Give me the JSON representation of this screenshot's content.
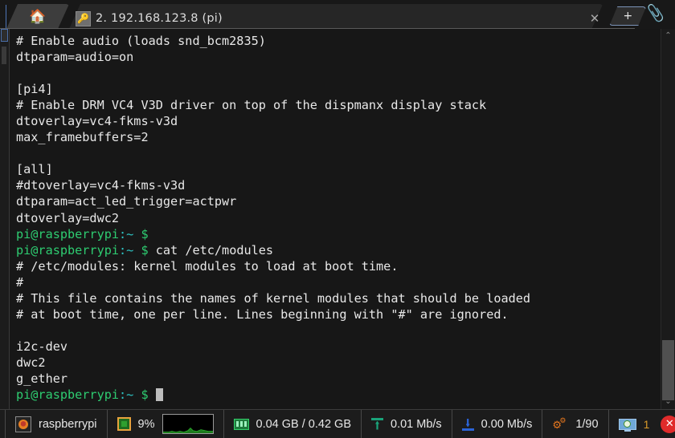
{
  "titlebar": {
    "home_tab": {
      "icon": "home-icon",
      "glyph": "🏠"
    },
    "terminal_tab": {
      "icon": "key-icon",
      "glyph": "🔑",
      "title": "2. 192.168.123.8 (pi)",
      "close_glyph": "✕"
    },
    "new_tab": {
      "label": "+"
    },
    "attachment": {
      "icon": "paperclip-icon",
      "glyph": "📎"
    }
  },
  "terminal": {
    "prompt_user": "pi@raspberrypi",
    "prompt_path": ":~",
    "prompt_sym": "$",
    "lines": [
      {
        "type": "plain",
        "text": "# Enable audio (loads snd_bcm2835)"
      },
      {
        "type": "plain",
        "text": "dtparam=audio=on"
      },
      {
        "type": "plain",
        "text": ""
      },
      {
        "type": "plain",
        "text": "[pi4]"
      },
      {
        "type": "plain",
        "text": "# Enable DRM VC4 V3D driver on top of the dispmanx display stack"
      },
      {
        "type": "plain",
        "text": "dtoverlay=vc4-fkms-v3d"
      },
      {
        "type": "plain",
        "text": "max_framebuffers=2"
      },
      {
        "type": "plain",
        "text": ""
      },
      {
        "type": "plain",
        "text": "[all]"
      },
      {
        "type": "plain",
        "text": "#dtoverlay=vc4-fkms-v3d"
      },
      {
        "type": "plain",
        "text": "dtparam=act_led_trigger=actpwr"
      },
      {
        "type": "plain",
        "text": "dtoverlay=dwc2"
      },
      {
        "type": "prompt",
        "command": ""
      },
      {
        "type": "prompt",
        "command": " cat /etc/modules"
      },
      {
        "type": "plain",
        "text": "# /etc/modules: kernel modules to load at boot time."
      },
      {
        "type": "plain",
        "text": "#"
      },
      {
        "type": "plain",
        "text": "# This file contains the names of kernel modules that should be loaded"
      },
      {
        "type": "plain",
        "text": "# at boot time, one per line. Lines beginning with \"#\" are ignored."
      },
      {
        "type": "plain",
        "text": ""
      },
      {
        "type": "plain",
        "text": "i2c-dev"
      },
      {
        "type": "plain",
        "text": "dwc2"
      },
      {
        "type": "plain",
        "text": "g_ether"
      },
      {
        "type": "prompt_cursor",
        "command": " "
      }
    ],
    "scrollbar": {
      "up_glyph": "⌃",
      "down_glyph": "⌄"
    }
  },
  "statusbar": {
    "hostname": {
      "icon": "raspberry-icon",
      "label": "raspberrypi"
    },
    "cpu": {
      "icon": "cpu-icon",
      "value": "9%"
    },
    "cpu_graph": {
      "icon": "cpu-graph"
    },
    "memory": {
      "icon": "ram-icon",
      "value": "0.04 GB / 0.42 GB"
    },
    "upload": {
      "icon": "upload-arrow-icon",
      "value": "0.01 Mb/s"
    },
    "download": {
      "icon": "download-arrow-icon",
      "value": "0.00 Mb/s"
    },
    "processes": {
      "icon": "gears-icon",
      "value": "1/90"
    },
    "sessions": {
      "icon": "monitor-icon",
      "value": "1"
    },
    "close": {
      "icon": "close-icon",
      "glyph": "✕"
    }
  },
  "colors": {
    "prompt_green": "#2ecc71",
    "prompt_cyan": "#2ec4c4",
    "terminal_text": "#e8e8e8",
    "terminal_bg": "#171717",
    "accent_blue": "#3f51b5",
    "close_red": "#e02b2b"
  }
}
